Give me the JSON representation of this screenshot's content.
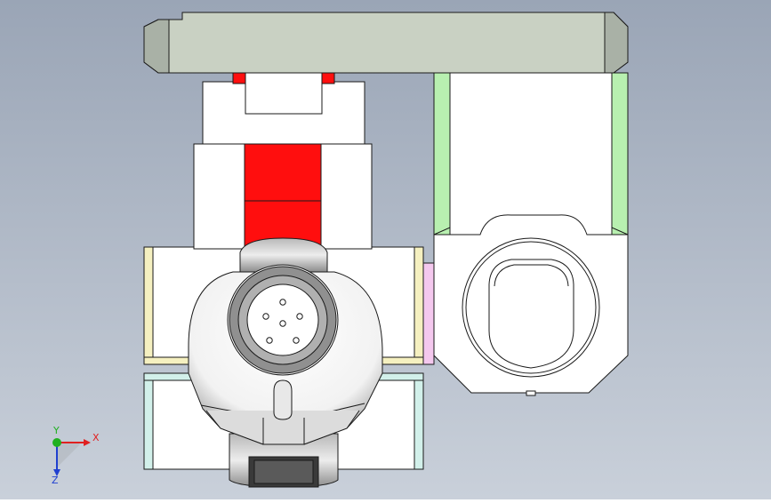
{
  "view": {
    "background_top": "#9aa5b6",
    "background_bottom": "#c9d0da"
  },
  "part_colors": {
    "top_bar": "#c9d1c3",
    "top_bar_bevel": "#a9b1a6",
    "body_face": "#ffffff",
    "red_channel": "#ff0e0e",
    "green_edge": "#b8f0b0",
    "yellow_edge": "#f5f0c0",
    "cyan_edge": "#d2f0ea",
    "pink_edge": "#f4c8ee",
    "outline": "#1a1a1a",
    "knob_gray": "#8f8f8f"
  },
  "triad": {
    "x_label": "X",
    "y_label": "Y",
    "z_label": "Z",
    "x_color": "#e02020",
    "y_color": "#20b020",
    "z_color": "#2040d0"
  }
}
